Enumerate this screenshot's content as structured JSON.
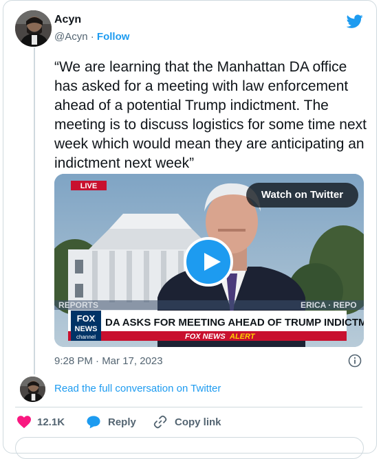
{
  "author": {
    "display_name": "Acyn",
    "handle": "@Acyn",
    "separator": " · ",
    "follow_label": "Follow"
  },
  "tweet": {
    "text": "“We are learning that the Manhattan DA office has asked for a meeting with law enforcement ahead of a potential Trump indictment. The meeting is to discuss logistics for some time next week which would mean they are anticipating an indictment next week”",
    "timestamp": "9:28 PM · Mar 17, 2023"
  },
  "media": {
    "watch_label": "Watch on Twitter",
    "live_badge": "LIVE",
    "chyron_headline": "DA ASKS FOR MEETING AHEAD OF TRUMP INDICTMENT",
    "alert_prefix": "FOX NEWS",
    "alert_word": "ALERT",
    "logo_line1": "FOX",
    "logo_line2": "NEWS",
    "logo_line3": "channel",
    "ticker_left": "REPORTS",
    "ticker_right": "ERICA · REPO"
  },
  "conversation": {
    "read_label": "Read the full conversation on Twitter"
  },
  "actions": {
    "like_count": "12.1K",
    "reply_label": "Reply",
    "copy_label": "Copy link"
  },
  "colors": {
    "accent": "#1d9bf0",
    "like": "#f91880",
    "text": "#0f1419",
    "muted": "#536471",
    "border": "#cfd9de"
  },
  "icons": [
    "twitter-bird-icon",
    "play-icon",
    "info-icon",
    "heart-icon",
    "reply-bubble-icon",
    "link-icon"
  ]
}
